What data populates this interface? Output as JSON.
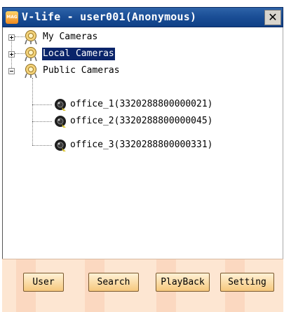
{
  "window": {
    "title": "V-life - user001(Anonymous)",
    "logo_text": "MAG",
    "close_glyph": "✕"
  },
  "tree": {
    "nodes": [
      {
        "label": "My Cameras",
        "expander": "plus",
        "icon": "camera-group-icon"
      },
      {
        "label": "Local Cameras",
        "expander": "plus",
        "icon": "camera-group-icon",
        "selected": true
      },
      {
        "label": "Public Cameras",
        "expander": "minus",
        "icon": "camera-group-icon"
      },
      {
        "label": "office_1(3320288800000021)",
        "icon": "camera-icon"
      },
      {
        "label": "office_2(3320288800000045)",
        "icon": "camera-icon"
      },
      {
        "label": "office_3(3320288800000331)",
        "icon": "camera-icon"
      }
    ]
  },
  "buttons": {
    "user": "User",
    "search": "Search",
    "playback": "PlayBack",
    "setting": "Setting"
  },
  "colors": {
    "titlebar": "#1b4f97",
    "selection": "#0a246a",
    "footer": "#fde6d2"
  }
}
